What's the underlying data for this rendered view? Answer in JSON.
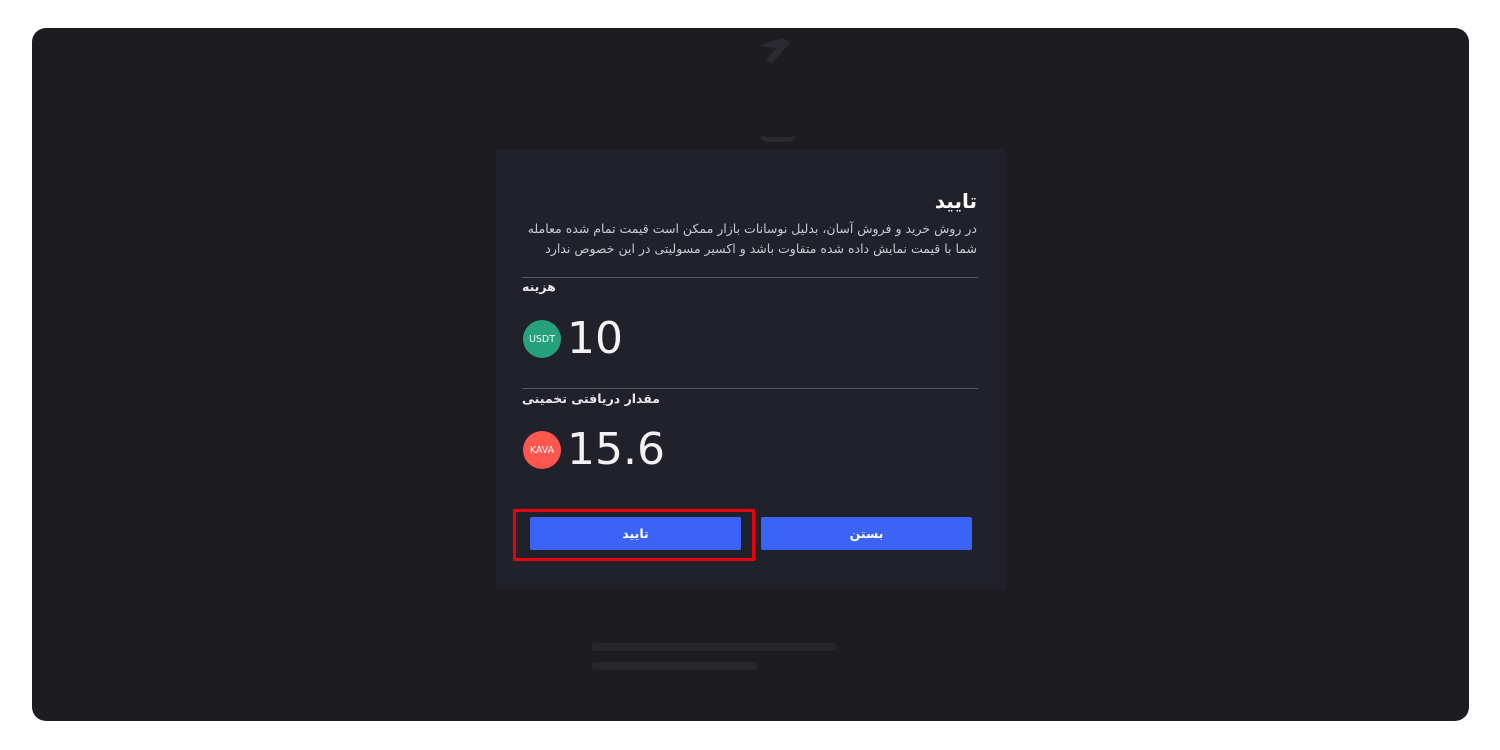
{
  "modal": {
    "title": "تایید",
    "description": "در روش خرید و فروش آسان، بدلیل نوسانات بازار ممکن است قیمت تمام شده معامله شما با قیمت نمایش داده شده متفاوت باشد و اکسیر مسولیتی در این خصوص ندارد",
    "cost": {
      "label": "هزینه",
      "coin": "USDT",
      "value": "10"
    },
    "estimate": {
      "label": "مقدار دریافتی تخمینی",
      "coin": "KAVA",
      "value": "15.6"
    },
    "confirm_label": "تایید",
    "close_label": "بستن"
  },
  "colors": {
    "primary_button": "#3b63f5",
    "usdt": "#26a17b",
    "kava": "#ff564f",
    "highlight": "#e8000d",
    "chat": "#1aa3e6"
  },
  "icons": [
    "usdt-coin-icon",
    "kava-coin-icon",
    "chat-icon",
    "logo-icon"
  ]
}
